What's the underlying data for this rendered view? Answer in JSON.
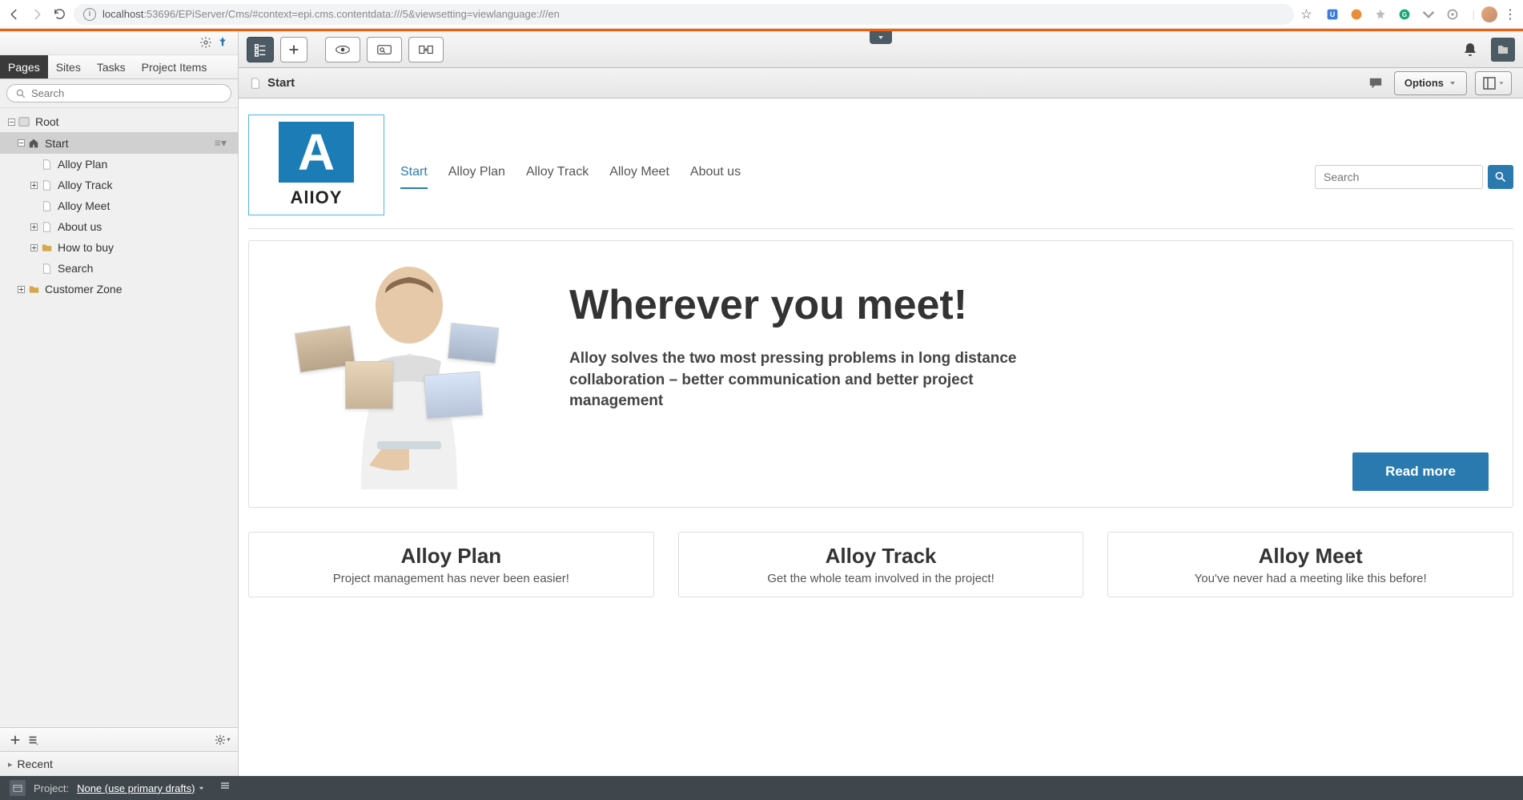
{
  "browser": {
    "url_host": "localhost",
    "url_port": ":53696",
    "url_path": "/EPiServer/Cms/#context=epi.cms.contentdata:///5&viewsetting=viewlanguage:///en"
  },
  "panel": {
    "tabs": [
      "Pages",
      "Sites",
      "Tasks",
      "Project Items"
    ],
    "active_tab": 0,
    "search_placeholder": "Search",
    "tree": {
      "root": "Root",
      "start": "Start",
      "children": [
        {
          "label": "Alloy Plan",
          "type": "page",
          "expand": false
        },
        {
          "label": "Alloy Track",
          "type": "page",
          "expand": true
        },
        {
          "label": "Alloy Meet",
          "type": "page",
          "expand": false
        },
        {
          "label": "About us",
          "type": "page",
          "expand": true
        },
        {
          "label": "How to buy",
          "type": "folder",
          "expand": true
        },
        {
          "label": "Search",
          "type": "page",
          "expand": false
        }
      ],
      "customer_zone": "Customer Zone"
    },
    "recent": "Recent"
  },
  "breadcrumb": {
    "title": "Start",
    "options_label": "Options"
  },
  "site": {
    "logo_letter": "A",
    "logo_text": "AlIOY",
    "nav": [
      "Start",
      "Alloy Plan",
      "Alloy Track",
      "Alloy Meet",
      "About us"
    ],
    "search_placeholder": "Search",
    "hero": {
      "title": "Wherever you meet!",
      "subtitle": "Alloy solves the two most pressing problems in long distance collaboration – better communication and better project management",
      "button": "Read more"
    },
    "cards": [
      {
        "title": "Alloy Plan",
        "sub": "Project management has never been easier!"
      },
      {
        "title": "Alloy Track",
        "sub": "Get the whole team involved in the project!"
      },
      {
        "title": "Alloy Meet",
        "sub": "You've never had a meeting like this before!"
      }
    ]
  },
  "project_bar": {
    "label": "Project:",
    "value": "None (use primary drafts)"
  }
}
